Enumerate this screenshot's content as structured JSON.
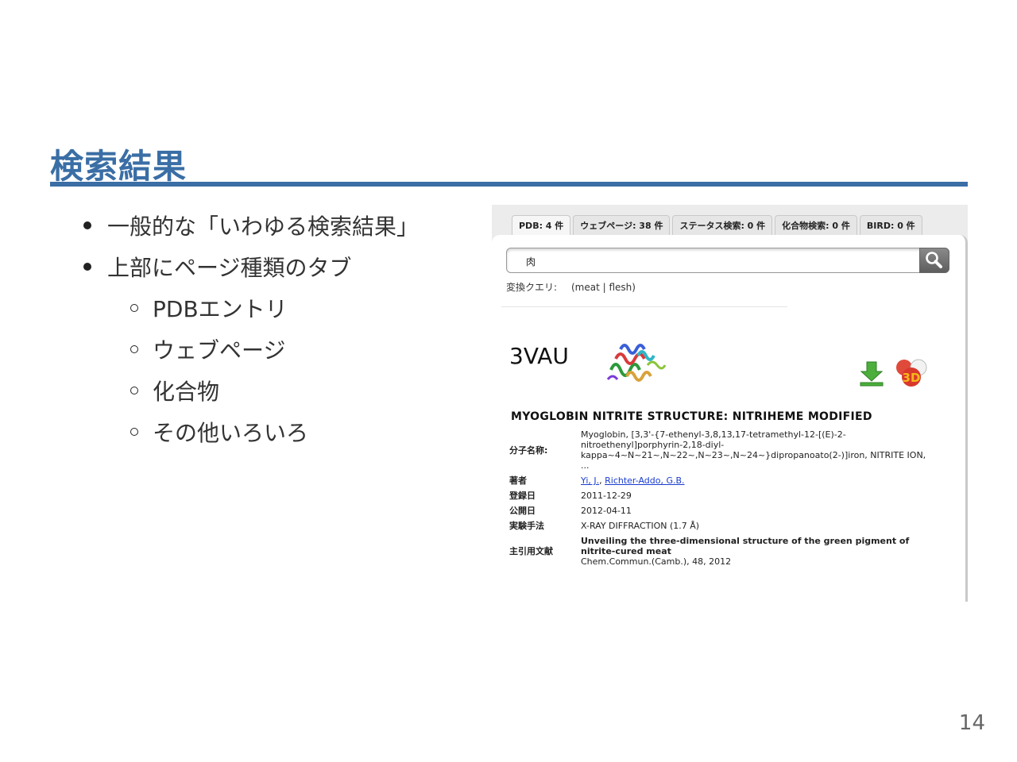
{
  "slide": {
    "title": "検索結果",
    "page_number": "14",
    "bullets": [
      {
        "text": "一般的な「いわゆる検索結果」"
      },
      {
        "text": "上部にページ種類のタブ",
        "children": [
          "PDBエントリ",
          "ウェブページ",
          "化合物",
          "その他いろいろ"
        ]
      }
    ]
  },
  "screenshot": {
    "tabs": [
      {
        "label": "PDB: 4 件"
      },
      {
        "label": "ウェブページ: 38 件"
      },
      {
        "label": "ステータス検索: 0 件"
      },
      {
        "label": "化合物検索: 0 件"
      },
      {
        "label": "BIRD: 0 件"
      }
    ],
    "search": {
      "value": "肉"
    },
    "conversion": {
      "label": "変換クエリ:",
      "value": "(meat | flesh)"
    },
    "entry": {
      "id": "3VAU",
      "title": "MYOGLOBIN NITRITE STRUCTURE: NITRIHEME MODIFIED",
      "molecule_label": "分子名称:",
      "molecule_lines": [
        "Myoglobin, [3,3'-{7-ethenyl-3,8,13,17-tetramethyl-12-[(E)-2-",
        "nitroethenyl]porphyrin-2,18-diyl-",
        "kappa~4~N~21~,N~22~,N~23~,N~24~}dipropanoato(2-)]iron, NITRITE ION,",
        "..."
      ],
      "authors_label": "著者",
      "authors": [
        "Yi, J.",
        "Richter-Addo, G.B."
      ],
      "deposited_label": "登録日",
      "deposited": "2011-12-29",
      "released_label": "公開日",
      "released": "2012-04-11",
      "method_label": "実験手法",
      "method": "X-RAY DIFFRACTION (1.7 Å)",
      "citation_label": "主引用文献",
      "citation_title_lines": [
        "Unveiling the three-dimensional structure of the green pigment of",
        "nitrite-cured meat"
      ],
      "citation_journal": "Chem.Commun.(Camb.), 48, 2012"
    }
  }
}
